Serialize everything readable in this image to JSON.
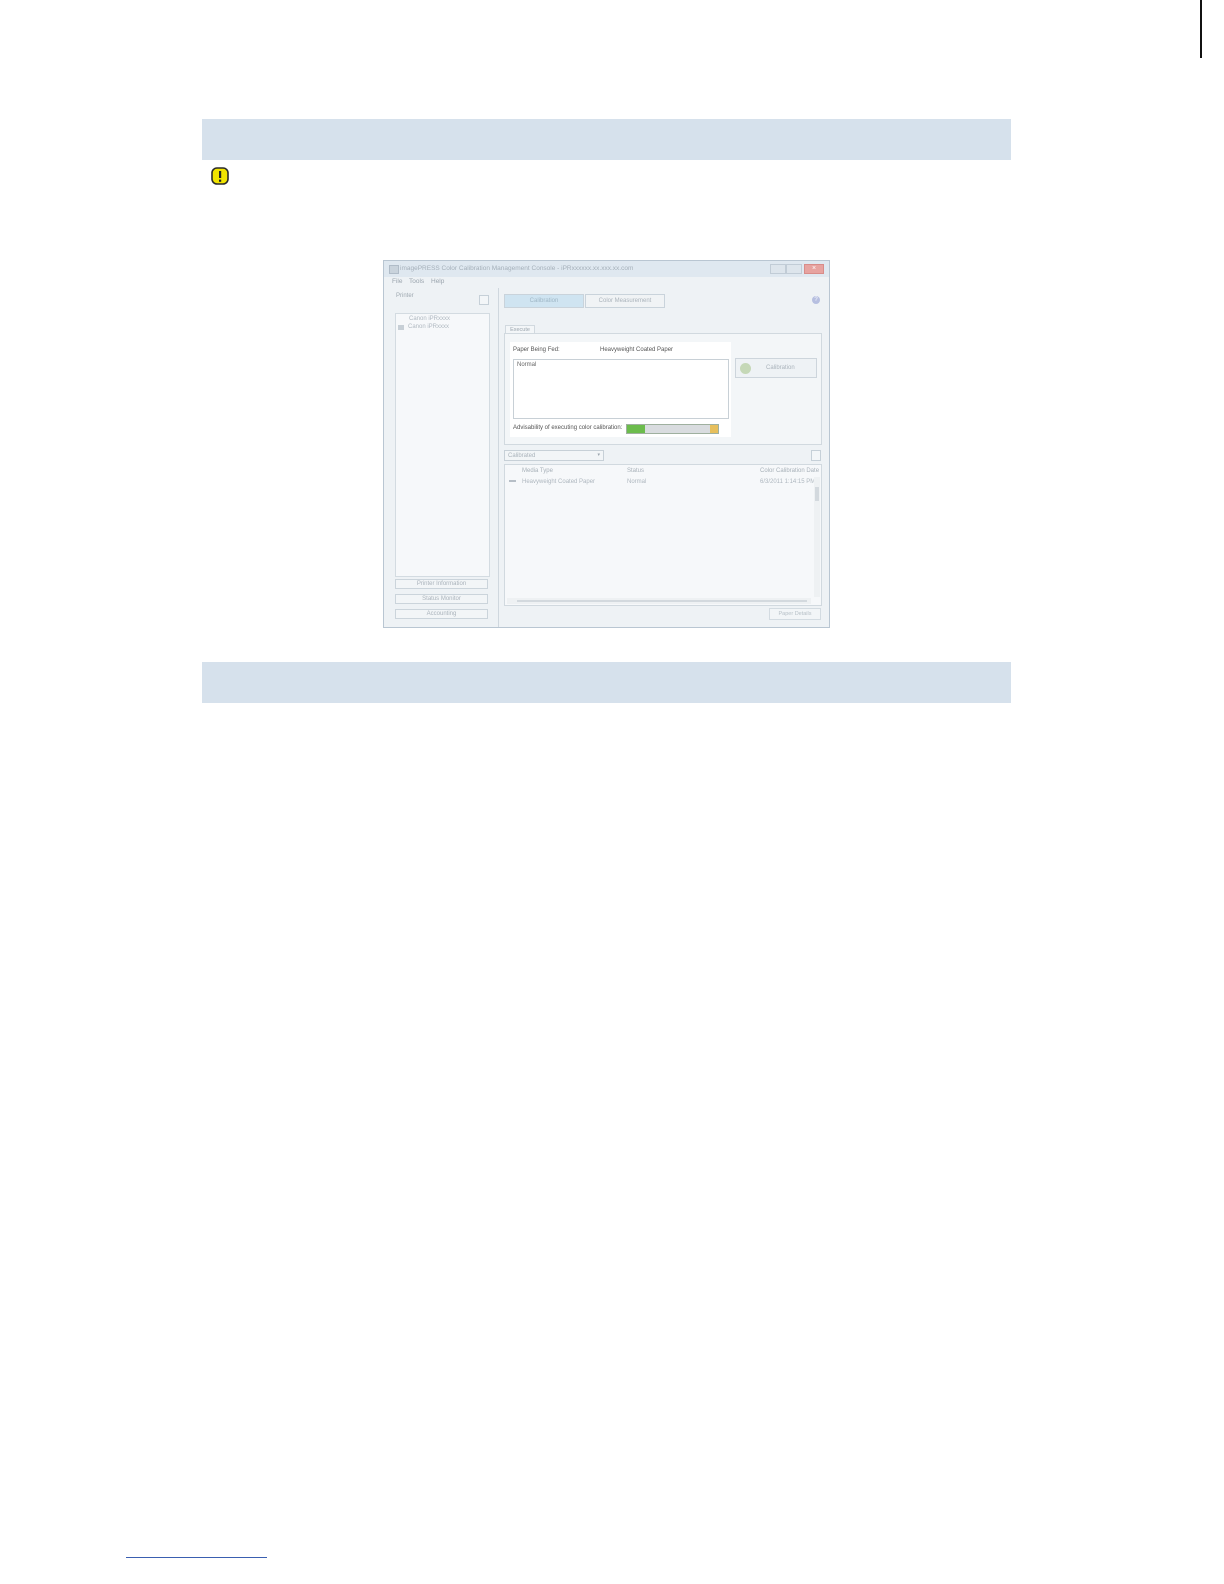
{
  "notice_icon": "warning-icon",
  "window": {
    "title": "imagePRESS Color Calibration Management Console - iPRxxxxxx.xx.xxx.xx.com",
    "close_glyph": "×",
    "menu": [
      "File",
      "Tools",
      "Help"
    ],
    "left_pane": {
      "label": "Printer",
      "tree": [
        "Canon iPRxxxx",
        "Canon iPRxxxx"
      ],
      "buttons": [
        "Printer Information",
        "Status Monitor",
        "Accounting"
      ]
    },
    "tabs": [
      "Calibration",
      "Color Measurement"
    ],
    "help_glyph": "?",
    "execute": {
      "tab_label": "Execute",
      "paper_label": "Paper Being Fed:",
      "paper_value": "Heavyweight Coated Paper",
      "message": "Normal",
      "advisability_label": "Advisability of executing color calibration:",
      "advisability_level": 0.2,
      "calibration_button": "Calibration"
    },
    "filter": {
      "selected": "Calibrated",
      "arrow": "▾"
    },
    "table": {
      "columns": [
        "Media Type",
        "Status",
        "Color Calibration Date"
      ],
      "rows": [
        {
          "media": "Heavyweight Coated Paper",
          "status": "Normal",
          "date": "6/3/2011 1:14:15 PM"
        }
      ]
    },
    "footer_button": "Paper Details"
  }
}
